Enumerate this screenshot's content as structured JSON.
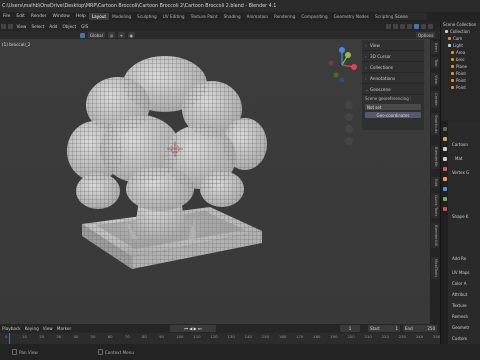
{
  "window": {
    "title": "C:\\Users\\malhb\\OneDrive\\Desktop\\MRP\\Cartoon Broccoli\\Cartoon Broccoli 2\\Cartoon Broccoli 2.blend - Blender 4.1"
  },
  "topbar": {
    "menus": [
      "File",
      "Edit",
      "Render",
      "Window",
      "Help"
    ],
    "workspaces": [
      "Layout",
      "Modeling",
      "Sculpting",
      "UV Editing",
      "Texture Paint",
      "Shading",
      "Animation",
      "Rendering",
      "Compositing",
      "Geometry Nodes",
      "Scripting"
    ],
    "active_workspace": "Layout",
    "scene_name": "Scene"
  },
  "viewport_header": {
    "menus": [
      "View",
      "Select",
      "Add",
      "Object",
      "GIS"
    ],
    "transform_orientation": "Global",
    "options_label": "Options"
  },
  "viewport": {
    "object_label": "(1) broccoli_2"
  },
  "npanel": {
    "sections": [
      "View",
      "3D Cursor",
      "Collections",
      "Annotations",
      "Geoscene"
    ],
    "georef_label": "Scene georeferencing :",
    "not_set": "Not set",
    "geo_coords": "Geo-coordinates"
  },
  "sidebar_tabs": [
    "Item",
    "Tool",
    "View",
    "Create",
    "Shortcuts",
    "BlenderKit",
    "Edit",
    "Quick Tools",
    "BlenderGIS",
    "MaxiTools"
  ],
  "outliner": {
    "items": [
      "Scene Collection",
      "Collection",
      "Cam",
      "Light",
      "Area",
      "broc",
      "Plane",
      "Point",
      "Point",
      "Point"
    ]
  },
  "properties": {
    "object_name": "Cartoon",
    "labels": [
      "Mat",
      "Vertex G",
      "Shape K",
      "Add Re",
      "UV Maps",
      "Color A",
      "Attribut",
      "Texture",
      "Remesh",
      "Geometr",
      "Custom"
    ]
  },
  "timeline": {
    "menus": [
      "Playback",
      "Keying",
      "View",
      "Marker"
    ],
    "current_frame": "1",
    "start_label": "Start",
    "start": "1",
    "end_label": "End",
    "end": "250",
    "ticks": [
      "0",
      "10",
      "20",
      "30",
      "40",
      "50",
      "60",
      "70",
      "80",
      "90",
      "100",
      "110",
      "120",
      "130",
      "140",
      "150",
      "160",
      "170",
      "180",
      "190",
      "200",
      "210",
      "220",
      "230",
      "240",
      "250"
    ]
  },
  "statusbar": {
    "items": [
      "Pan View",
      "Context Menu"
    ]
  },
  "colors": {
    "axis_x": "#e2464f",
    "axis_y": "#8bc040",
    "axis_z": "#4b86e3",
    "accent": "#4772b3",
    "mesh_fill": "#c9c9c9",
    "wire": "#5f5f5f"
  }
}
